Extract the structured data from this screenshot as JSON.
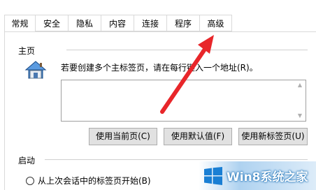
{
  "tabs": [
    {
      "label": "常规",
      "active": true
    },
    {
      "label": "安全",
      "active": false
    },
    {
      "label": "隐私",
      "active": false
    },
    {
      "label": "内容",
      "active": false
    },
    {
      "label": "连接",
      "active": false
    },
    {
      "label": "程序",
      "active": false
    },
    {
      "label": "高级",
      "active": false
    }
  ],
  "home": {
    "title": "主页",
    "description": "若要创建多个主标签页，请在每行键入一个地址(R)。",
    "url_value": "",
    "buttons": {
      "use_current": "使用当前页(C)",
      "use_default": "使用默认值(F)",
      "use_new_tab": "使用新标签页(U)"
    }
  },
  "startup": {
    "title": "启动",
    "option_1": "从上次会话中的标签页开始(B)"
  },
  "watermark": {
    "text": "Win8系统之家"
  },
  "colors": {
    "arrow": "#e8262a",
    "watermark": "#1a7fd4"
  },
  "icons": {
    "home": "home-icon",
    "arrow": "red-arrow-annotation",
    "windows_logo": "windows-logo-icon"
  }
}
